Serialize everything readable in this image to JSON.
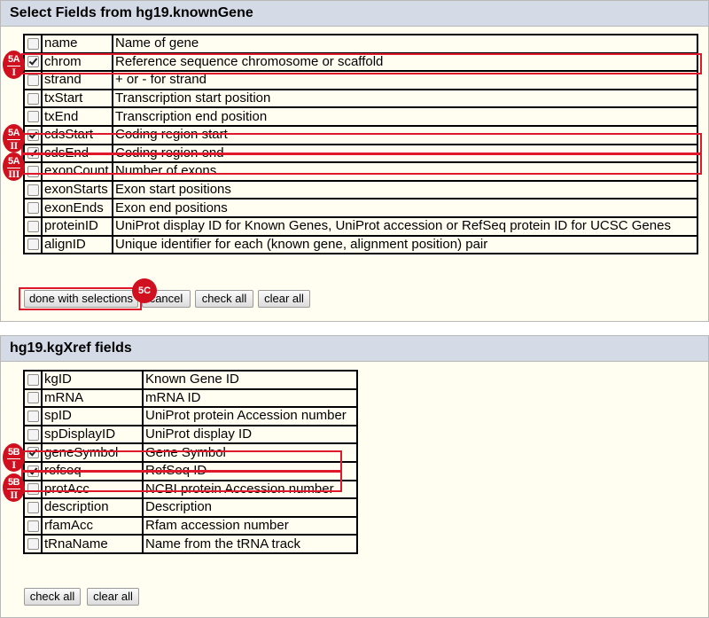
{
  "panel1": {
    "title": "Select Fields from hg19.knownGene",
    "fields": [
      {
        "name": "name",
        "desc": "Name of gene",
        "checked": false
      },
      {
        "name": "chrom",
        "desc": "Reference sequence chromosome or scaffold",
        "checked": true
      },
      {
        "name": "strand",
        "desc": "+ or - for strand",
        "checked": false
      },
      {
        "name": "txStart",
        "desc": "Transcription start position",
        "checked": false
      },
      {
        "name": "txEnd",
        "desc": "Transcription end position",
        "checked": false
      },
      {
        "name": "cdsStart",
        "desc": "Coding region start",
        "checked": true
      },
      {
        "name": "cdsEnd",
        "desc": "Coding region end",
        "checked": true
      },
      {
        "name": "exonCount",
        "desc": "Number of exons",
        "checked": false
      },
      {
        "name": "exonStarts",
        "desc": "Exon start positions",
        "checked": false
      },
      {
        "name": "exonEnds",
        "desc": "Exon end positions",
        "checked": false
      },
      {
        "name": "proteinID",
        "desc": "UniProt display ID for Known Genes, UniProt accession or RefSeq protein ID for UCSC Genes",
        "checked": false
      },
      {
        "name": "alignID",
        "desc": "Unique identifier for each (known gene, alignment position) pair",
        "checked": false
      }
    ],
    "buttons": {
      "done": "done with selections",
      "cancel": "cancel",
      "check_all": "check all",
      "clear_all": "clear all"
    }
  },
  "panel2": {
    "title": "hg19.kgXref fields",
    "fields": [
      {
        "name": "kgID",
        "desc": "Known Gene ID",
        "checked": false
      },
      {
        "name": "mRNA",
        "desc": "mRNA ID",
        "checked": false
      },
      {
        "name": "spID",
        "desc": "UniProt protein Accession number",
        "checked": false
      },
      {
        "name": "spDisplayID",
        "desc": "UniProt display ID",
        "checked": false
      },
      {
        "name": "geneSymbol",
        "desc": "Gene Symbol",
        "checked": true
      },
      {
        "name": "refseq",
        "desc": "RefSeq ID",
        "checked": true
      },
      {
        "name": "protAcc",
        "desc": "NCBI protein Accession number",
        "checked": false
      },
      {
        "name": "description",
        "desc": "Description",
        "checked": false
      },
      {
        "name": "rfamAcc",
        "desc": "Rfam accession number",
        "checked": false
      },
      {
        "name": "tRnaName",
        "desc": "Name from the tRNA track",
        "checked": false
      }
    ],
    "buttons": {
      "check_all": "check all",
      "clear_all": "clear all"
    }
  },
  "annotations": {
    "a5A_I": {
      "top": "5A",
      "sub": "I"
    },
    "a5A_II": {
      "top": "5A",
      "sub": "II"
    },
    "a5A_III": {
      "top": "5A",
      "sub": "III"
    },
    "a5B_I": {
      "top": "5B",
      "sub": "I"
    },
    "a5B_II": {
      "top": "5B",
      "sub": "II"
    },
    "a5C": "5C",
    "color": "#e0182c"
  }
}
